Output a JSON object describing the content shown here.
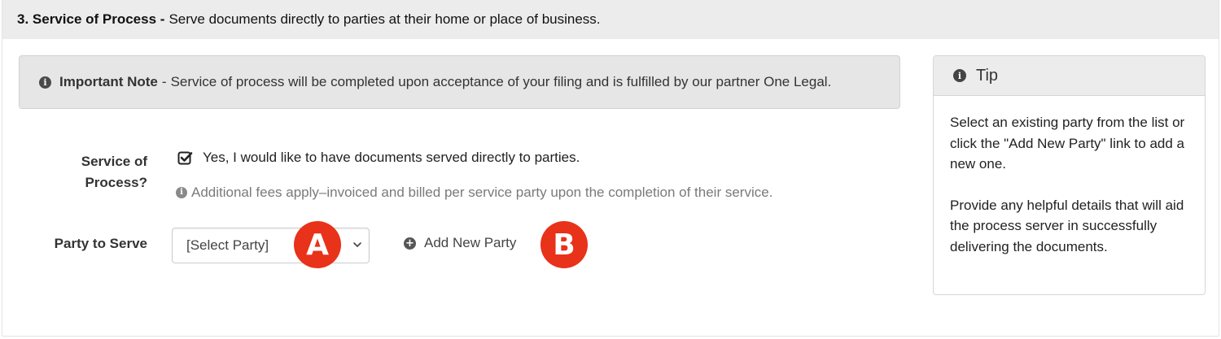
{
  "section": {
    "number_title": "3. Service of Process -",
    "description": "Serve documents directly to parties at their home or place of business."
  },
  "note": {
    "icon": "info-icon",
    "title": "Important Note",
    "separator": "-",
    "text": "Service of process will be completed upon acceptance of your filing and is fulfilled by our partner One Legal."
  },
  "form": {
    "service_label_line1": "Service of",
    "service_label_line2": "Process?",
    "checkbox_checked": true,
    "checkbox_label": "Yes, I would like to have documents served directly to parties.",
    "help_text": "Additional fees apply–invoiced and billed per service party upon the completion of their service.",
    "party_label": "Party to Serve",
    "party_select_value": "[Select Party]",
    "add_party_label": "Add New Party"
  },
  "annotations": {
    "a": "A",
    "b": "B",
    "color": "#e83219"
  },
  "tip": {
    "title": "Tip",
    "paragraph1": "Select an existing party from the list or click the \"Add New Party\" link to add a new one.",
    "paragraph2": "Provide any helpful details that will aid the process server in successfully delivering the documents."
  }
}
